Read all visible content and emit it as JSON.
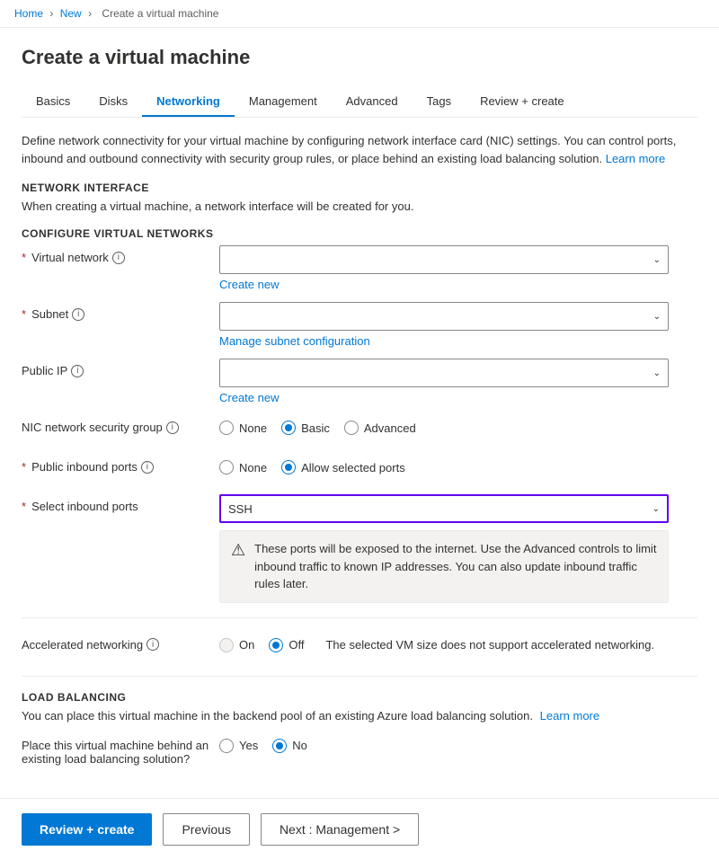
{
  "breadcrumb": {
    "items": [
      "Home",
      "New",
      "Create a virtual machine"
    ]
  },
  "page": {
    "title": "Create a virtual machine"
  },
  "tabs": [
    {
      "label": "Basics",
      "active": false
    },
    {
      "label": "Disks",
      "active": false
    },
    {
      "label": "Networking",
      "active": true
    },
    {
      "label": "Management",
      "active": false
    },
    {
      "label": "Advanced",
      "active": false
    },
    {
      "label": "Tags",
      "active": false
    },
    {
      "label": "Review + create",
      "active": false
    }
  ],
  "description": {
    "main": "Define network connectivity for your virtual machine by configuring network interface card (NIC) settings. You can control ports, inbound and outbound connectivity with security group rules, or place behind an existing load balancing solution.",
    "learn_more": "Learn more"
  },
  "network_interface": {
    "header": "NETWORK INTERFACE",
    "desc": "When creating a virtual machine, a network interface will be created for you."
  },
  "configure_vnet": {
    "header": "CONFIGURE VIRTUAL NETWORKS",
    "fields": {
      "virtual_network": {
        "label": "Virtual network",
        "required": true,
        "value": "",
        "create_new": "Create new"
      },
      "subnet": {
        "label": "Subnet",
        "required": true,
        "value": "",
        "manage_link": "Manage subnet configuration"
      },
      "public_ip": {
        "label": "Public IP",
        "required": false,
        "value": "",
        "create_new": "Create new"
      },
      "nic_security_group": {
        "label": "NIC network security group",
        "required": false,
        "options": [
          "None",
          "Basic",
          "Advanced"
        ],
        "selected": "Basic"
      },
      "public_inbound_ports": {
        "label": "Public inbound ports",
        "required": true,
        "options": [
          "None",
          "Allow selected ports"
        ],
        "selected": "Allow selected ports"
      },
      "select_inbound_ports": {
        "label": "Select inbound ports",
        "required": true,
        "value": "SSH",
        "warning": "These ports will be exposed to the internet. Use the Advanced controls to limit inbound traffic to known IP addresses. You can also update inbound traffic rules later."
      }
    }
  },
  "accelerated_networking": {
    "label": "Accelerated networking",
    "options": [
      "On",
      "Off"
    ],
    "selected": "Off",
    "note": "The selected VM size does not support accelerated networking."
  },
  "load_balancing": {
    "header": "LOAD BALANCING",
    "desc_main": "You can place this virtual machine in the backend pool of an existing Azure load balancing solution.",
    "learn_more": "Learn more",
    "place_label": "Place this virtual machine behind an existing load balancing solution?",
    "options": [
      "Yes",
      "No"
    ],
    "selected": "No"
  },
  "footer": {
    "review_create": "Review + create",
    "previous": "Previous",
    "next": "Next : Management >"
  },
  "icons": {
    "chevron_down": "&#8964;",
    "warning": "⚠",
    "info": "i"
  }
}
